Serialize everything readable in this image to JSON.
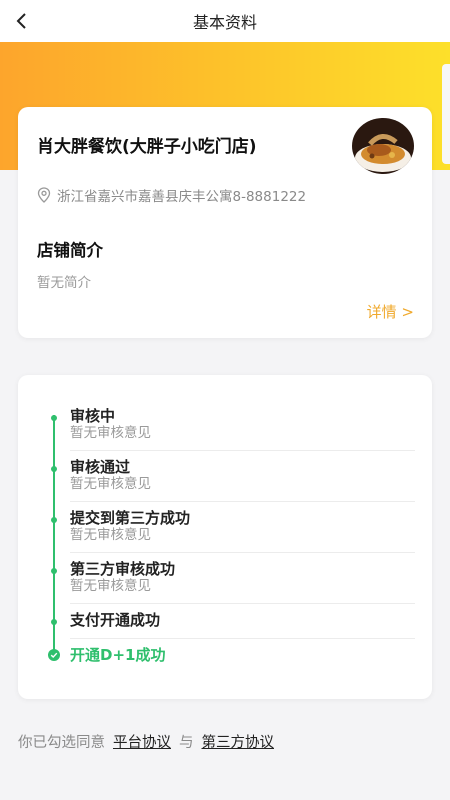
{
  "header": {
    "title": "基本资料",
    "back_icon": "chevron-left-icon"
  },
  "colors": {
    "banner_start": "#fda52c",
    "banner_end": "#fde02a",
    "accent": "#f0a92c",
    "success": "#2fbf6d"
  },
  "shop": {
    "name": "肖大胖餐饮(大胖子小吃门店)",
    "address": "浙江省嘉兴市嘉善县庆丰公寓8-8881222",
    "intro_title": "店铺简介",
    "intro_text": "暂无简介",
    "details_label": "详情 >"
  },
  "review": {
    "steps": [
      {
        "title": "审核中",
        "sub": "暂无审核意见"
      },
      {
        "title": "审核通过",
        "sub": "暂无审核意见"
      },
      {
        "title": "提交到第三方成功",
        "sub": "暂无审核意见"
      },
      {
        "title": "第三方审核成功",
        "sub": "暂无审核意见"
      },
      {
        "title": "支付开通成功",
        "sub": ""
      },
      {
        "title": "开通D+1成功",
        "sub": ""
      }
    ]
  },
  "agreement": {
    "prefix": "你已勾选同意",
    "platform_link": "平台协议",
    "conjunction": "与",
    "third_party_link": "第三方协议"
  }
}
